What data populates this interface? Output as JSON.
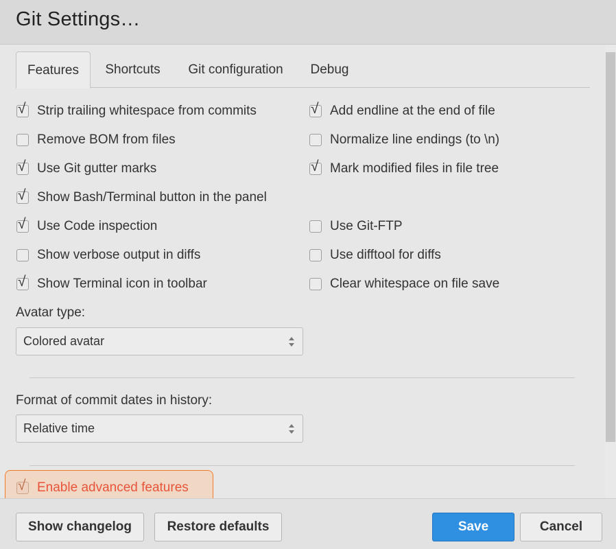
{
  "dialog": {
    "title": "Git Settings…"
  },
  "tabs": [
    {
      "label": "Features",
      "active": true
    },
    {
      "label": "Shortcuts",
      "active": false
    },
    {
      "label": "Git configuration",
      "active": false
    },
    {
      "label": "Debug",
      "active": false
    }
  ],
  "features": {
    "left": [
      {
        "label": "Strip trailing whitespace from commits",
        "checked": true
      },
      {
        "label": "Remove BOM from files",
        "checked": false
      },
      {
        "label": "Use Git gutter marks",
        "checked": true
      },
      {
        "label": "Show Bash/Terminal button in the panel",
        "checked": true
      },
      {
        "label": "Use Code inspection",
        "checked": true
      },
      {
        "label": "Show verbose output in diffs",
        "checked": false
      },
      {
        "label": "Show Terminal icon in toolbar",
        "checked": true
      }
    ],
    "right": [
      {
        "label": "Add endline at the end of file",
        "checked": true
      },
      {
        "label": "Normalize line endings (to \\n)",
        "checked": false
      },
      {
        "label": "Mark modified files in file tree",
        "checked": true
      },
      {
        "label": "Use Git-FTP",
        "checked": false
      },
      {
        "label": "Use difftool for diffs",
        "checked": false
      },
      {
        "label": "Clear whitespace on file save",
        "checked": false
      }
    ]
  },
  "avatar": {
    "label": "Avatar type:",
    "value": "Colored avatar"
  },
  "date_format": {
    "label": "Format of commit dates in history:",
    "value": "Relative time"
  },
  "advanced": {
    "label": "Enable advanced features",
    "checked": true
  },
  "footer": {
    "changelog_label": "Show changelog",
    "restore_label": "Restore defaults",
    "save_label": "Save",
    "cancel_label": "Cancel"
  },
  "colors": {
    "accent": "#2f8fe0",
    "highlight_border": "#f07a2a",
    "highlight_text": "#e8533b"
  },
  "icons": {
    "checkmark": "checkmark-icon",
    "select_arrows": "updown-arrows-icon"
  }
}
